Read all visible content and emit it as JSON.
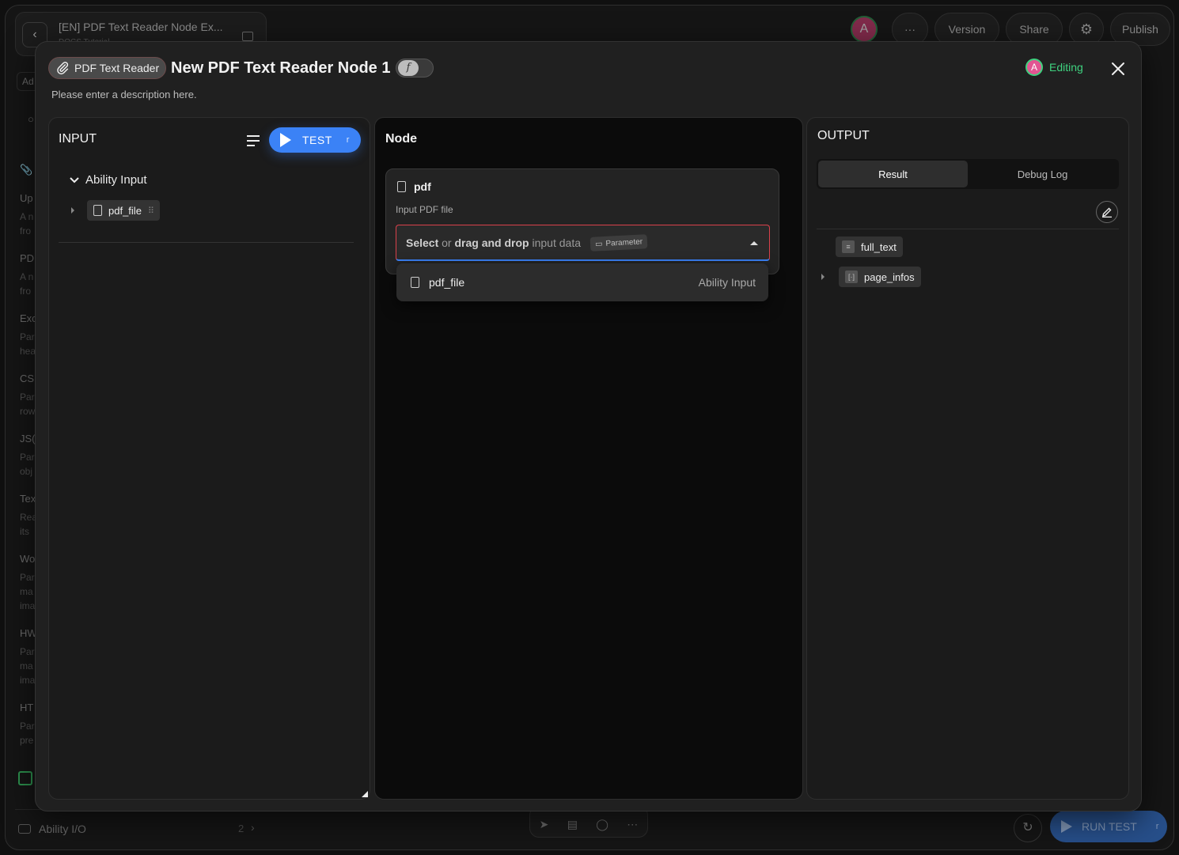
{
  "background": {
    "doc_title": "[EN] PDF Text Reader Node Ex...",
    "doc_subtitle": "DOCS Tutorial",
    "avatar_initial": "A",
    "more_label": "···",
    "version_label": "Version",
    "share_label": "Share",
    "publish_label": "Publish",
    "sidebar_add": "Ad",
    "sidebar_items": [
      {
        "title": "Up",
        "sub1": "A n",
        "sub2": "fro"
      },
      {
        "title": "PD",
        "sub1": "A n",
        "sub2": "fro"
      },
      {
        "title": "Exc",
        "sub1": "Par",
        "sub2": "hea"
      },
      {
        "title": "CS",
        "sub1": "Par",
        "sub2": "row"
      },
      {
        "title": "JS(",
        "sub1": "Par",
        "sub2": "obj"
      },
      {
        "title": "Tex",
        "sub1": "Rea",
        "sub2": "its"
      },
      {
        "title": "Wo",
        "sub1": "Par",
        "sub2": "ma",
        "sub3": "ima"
      },
      {
        "title": "HW",
        "sub1": "Par",
        "sub2": "ma",
        "sub3": "ima"
      },
      {
        "title": "HT",
        "sub1": "Par",
        "sub2": "pre"
      }
    ],
    "ability_io_label": "Ability I/O",
    "ability_io_count": "2",
    "run_test_label": "RUN TEST",
    "run_test_key": "r"
  },
  "modal": {
    "node_type": "PDF Text Reader",
    "node_title": "New PDF Text Reader Node 1",
    "fn_symbol": "f",
    "description": "Please enter a description here.",
    "status_avatar": "A",
    "status": "Editing"
  },
  "input_panel": {
    "heading": "INPUT",
    "test_label": "TEST",
    "test_key": "r",
    "group_label": "Ability Input",
    "item_label": "pdf_file"
  },
  "node_panel": {
    "heading": "Node",
    "field_name": "pdf",
    "field_description": "Input PDF file",
    "select_prefix": "Select",
    "select_or": "or",
    "select_drag": "drag and drop",
    "select_suffix": "input data",
    "param_tag": "Parameter",
    "dropdown_option": {
      "name": "pdf_file",
      "source": "Ability Input"
    }
  },
  "output_panel": {
    "heading": "OUTPUT",
    "tabs": [
      {
        "label": "Result",
        "active": true
      },
      {
        "label": "Debug Log",
        "active": false
      }
    ],
    "items": [
      {
        "label": "full_text",
        "icon": "text-lines-icon"
      },
      {
        "label": "page_infos",
        "icon": "array-brackets-icon"
      }
    ]
  },
  "colors": {
    "accent_blue": "#3b82f6",
    "editing_green": "#3fd27f",
    "error_red": "#d9414b"
  }
}
